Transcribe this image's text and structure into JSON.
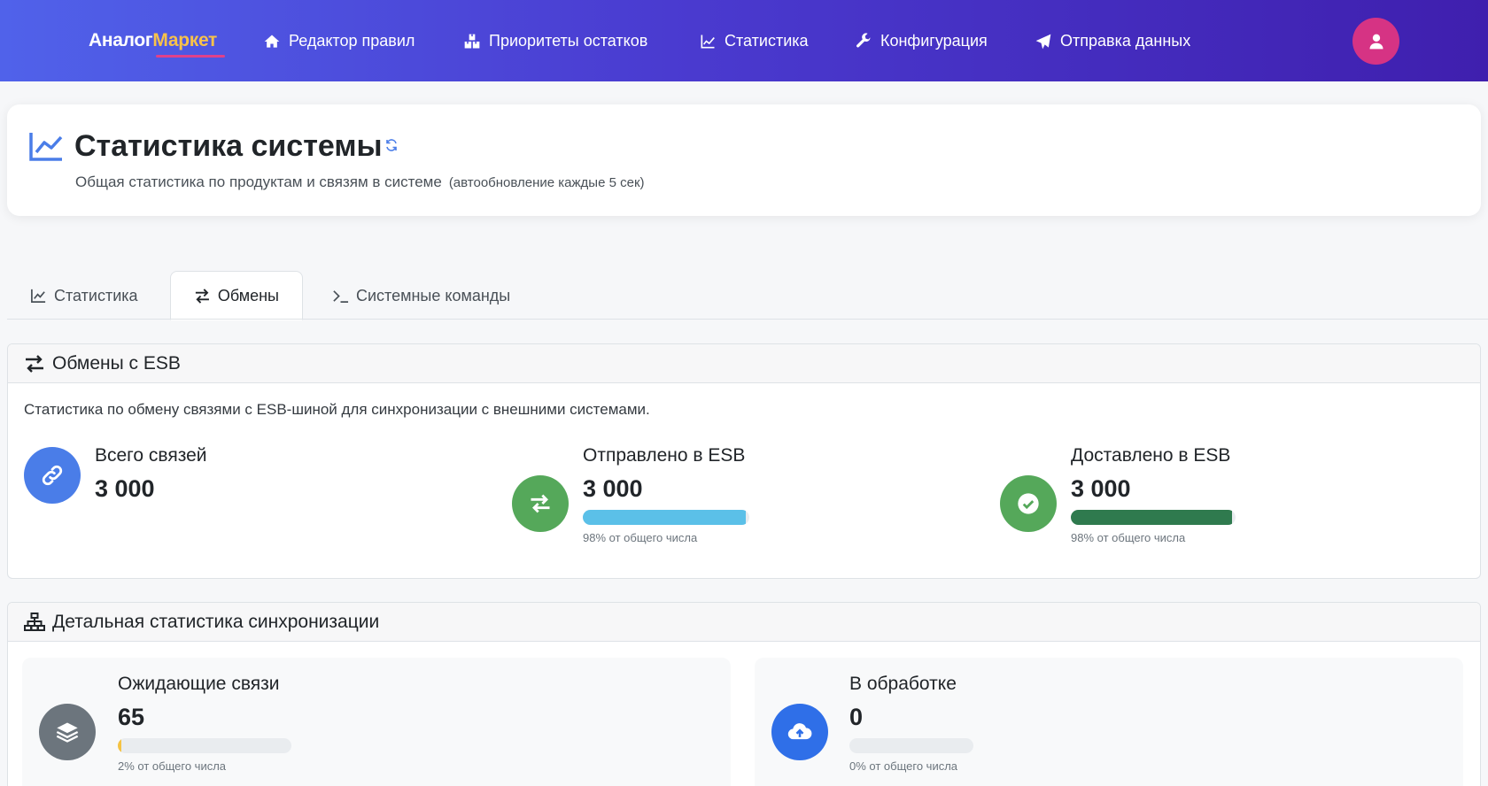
{
  "nav": {
    "brand_part1": "Аналог",
    "brand_part2": "Маркет",
    "items": [
      {
        "label": "Редактор правил",
        "icon": "home-icon"
      },
      {
        "label": "Приоритеты остатков",
        "icon": "boxes-icon"
      },
      {
        "label": "Статистика",
        "icon": "chart-line-icon"
      },
      {
        "label": "Конфигурация",
        "icon": "wrench-icon"
      },
      {
        "label": "Отправка данных",
        "icon": "paper-plane-icon"
      }
    ],
    "avatar_icon": "user-icon"
  },
  "header": {
    "title": "Статистика системы",
    "subtitle": "Общая статистика по продуктам и связям в системе",
    "autorefresh": "(автообновление каждые 5 сек)"
  },
  "tabs": [
    {
      "label": "Статистика",
      "active": false,
      "icon": "chart-line-icon"
    },
    {
      "label": "Обмены",
      "active": true,
      "icon": "exchange-icon"
    },
    {
      "label": "Системные команды",
      "active": false,
      "icon": "terminal-icon"
    }
  ],
  "esb": {
    "title": "Обмены с ESB",
    "description": "Статистика по обмену связями с ESB-шиной для синхронизации с внешними системами.",
    "stats": [
      {
        "label": "Всего связей",
        "value": "3 000",
        "icon": "link-icon",
        "color": "#4a7de8"
      },
      {
        "label": "Отправлено в ESB",
        "value": "3 000",
        "icon": "exchange-icon",
        "color": "#55a85a",
        "percent": 98,
        "bar_color": "#5bc0e8",
        "caption": "98% от общего числа"
      },
      {
        "label": "Доставлено в ESB",
        "value": "3 000",
        "icon": "check-circle-icon",
        "color": "#55a85a",
        "percent": 98,
        "bar_color": "#2f7a4e",
        "caption": "98% от общего числа"
      }
    ]
  },
  "sync": {
    "title": "Детальная статистика синхронизации",
    "stats": [
      {
        "label": "Ожидающие связи",
        "value": "65",
        "icon": "layers-icon",
        "color": "#6c757d",
        "percent": 2,
        "bar_color": "#f5c343",
        "caption": "2% от общего числа"
      },
      {
        "label": "В обработке",
        "value": "0",
        "icon": "cloud-upload-icon",
        "color": "#2f6fe8",
        "percent": 0,
        "bar_color": "#2f6fe8",
        "caption": "0% от общего числа"
      }
    ]
  }
}
